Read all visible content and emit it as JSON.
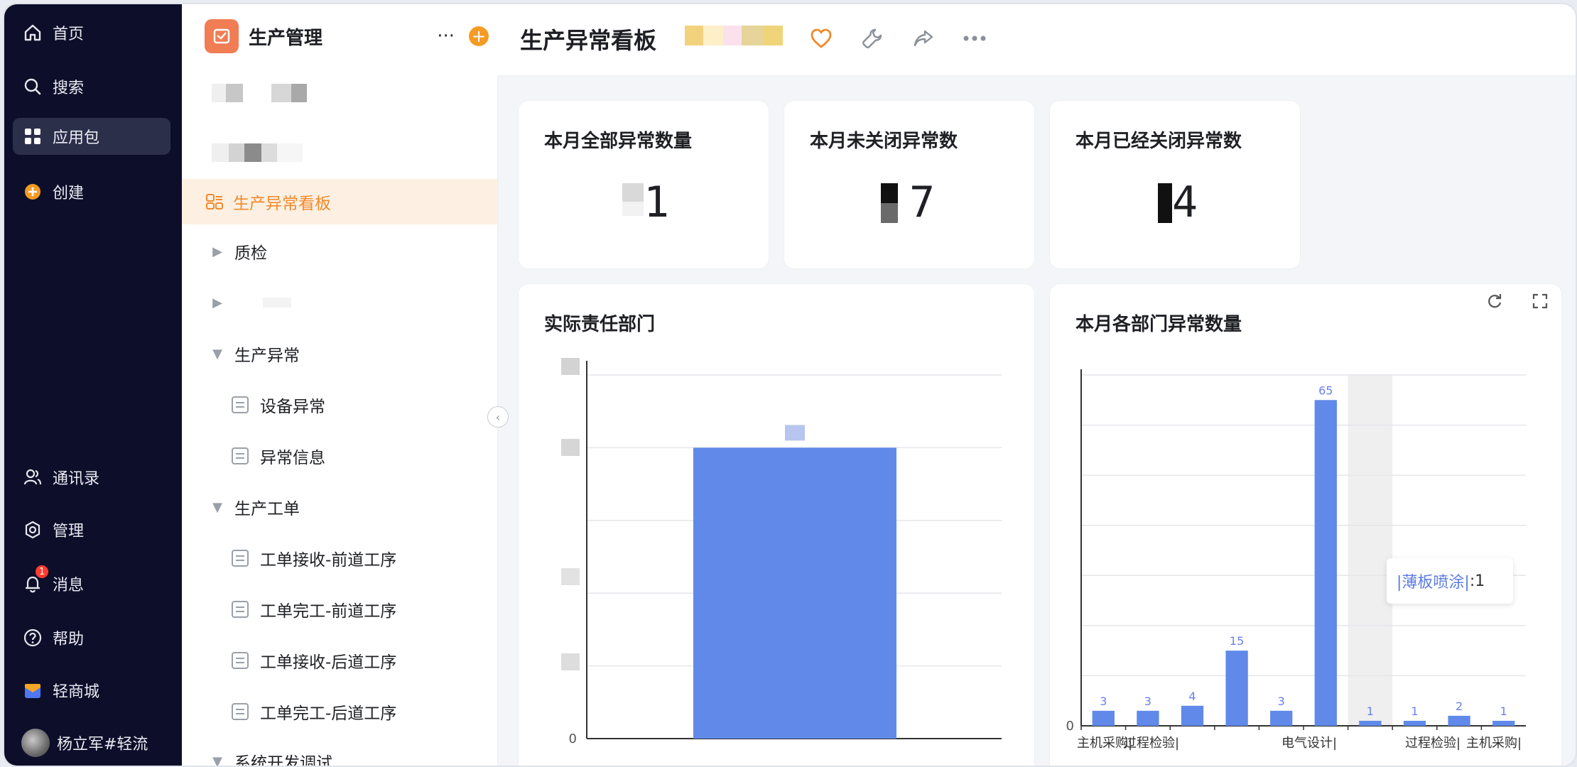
{
  "sidebar": {
    "items": [
      {
        "label": "首页",
        "icon": "home-icon"
      },
      {
        "label": "搜索",
        "icon": "search-icon"
      },
      {
        "label": "应用包",
        "icon": "apps-icon"
      },
      {
        "label": "创建",
        "icon": "plus-circle-icon"
      }
    ],
    "bottom": [
      {
        "label": "通讯录",
        "icon": "contacts-icon"
      },
      {
        "label": "管理",
        "icon": "gear-icon"
      },
      {
        "label": "消息",
        "icon": "bell-icon",
        "badge": "1"
      },
      {
        "label": "帮助",
        "icon": "help-icon"
      },
      {
        "label": "轻商城",
        "icon": "store-icon"
      }
    ],
    "user": {
      "name": "杨立军#轻流"
    }
  },
  "panel": {
    "title": "生产管理",
    "more": "···",
    "add": "+",
    "active": "生产异常看板",
    "tree": [
      {
        "label": "质检",
        "type": "folder-collapsed"
      },
      {
        "label": "生产异常",
        "type": "folder-expanded"
      },
      {
        "label": "设备异常",
        "type": "doc"
      },
      {
        "label": "异常信息",
        "type": "doc"
      },
      {
        "label": "生产工单",
        "type": "folder-expanded"
      },
      {
        "label": "工单接收-前道工序",
        "type": "doc"
      },
      {
        "label": "工单完工-前道工序",
        "type": "doc"
      },
      {
        "label": "工单接收-后道工序",
        "type": "doc"
      },
      {
        "label": "工单完工-后道工序",
        "type": "doc"
      },
      {
        "label": "系统开发调试",
        "type": "folder-expanded"
      }
    ]
  },
  "main": {
    "title": "生产异常看板",
    "colors": {
      "accent": "#f08a2b",
      "bar": "#6089e9",
      "barLabel": "#6a7ff0"
    }
  },
  "stats": [
    {
      "title": "本月全部异常数量",
      "value": "1"
    },
    {
      "title": "本月未关闭异常数",
      "value": "7"
    },
    {
      "title": "本月已经关闭异常数",
      "value": "4"
    }
  ],
  "chart_data": [
    {
      "type": "bar",
      "title": "实际责任部门",
      "y_ticks": [
        "0"
      ],
      "values": [
        0.8
      ],
      "ylim": [
        0,
        1
      ]
    },
    {
      "type": "bar",
      "title": "本月各部门异常数量",
      "x_labels": [
        "主机采购|",
        "过程检验|",
        "",
        "电气设计|",
        "",
        "",
        "过程检验|",
        "主机采购|"
      ],
      "y_ticks": [
        "0"
      ],
      "values": [
        3,
        3,
        4,
        15,
        3,
        65,
        1,
        1,
        2,
        1
      ],
      "ylim": [
        0,
        70
      ],
      "highlight_index": 6,
      "tooltip": {
        "name": "|薄板喷涂|",
        "value": "1",
        "separator": ": "
      }
    }
  ]
}
